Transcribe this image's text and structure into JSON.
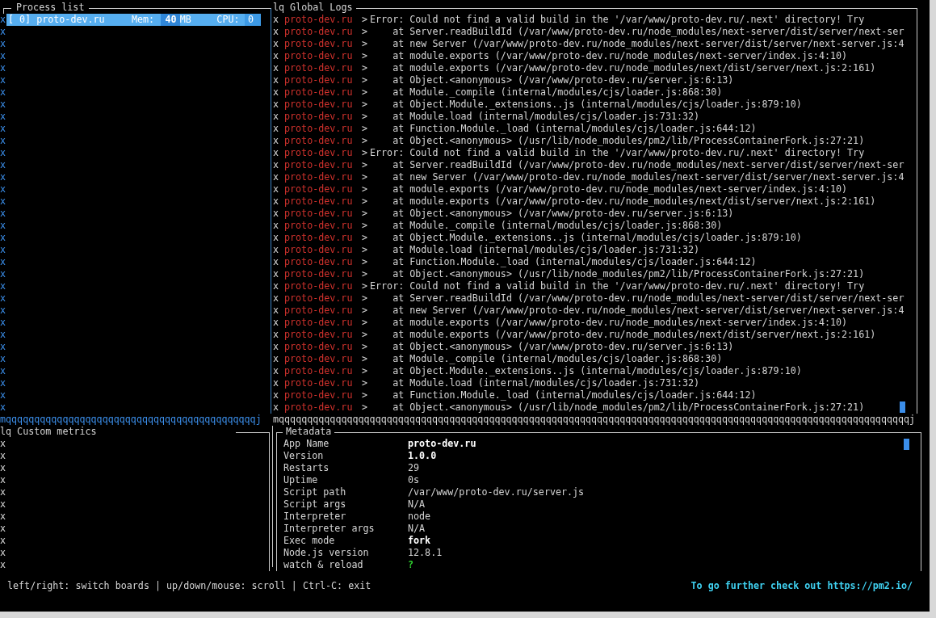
{
  "process_list": {
    "title": "Process list",
    "edge_marks": [
      "x",
      "x",
      "x",
      "x",
      "x",
      "x",
      "x",
      "x",
      "x",
      "x",
      "x",
      "x",
      "x",
      "x",
      "x",
      "x",
      "x",
      "x",
      "x",
      "x",
      "x",
      "x",
      "x",
      "x",
      "x",
      "x",
      "x",
      "x",
      "x",
      "x",
      "x",
      "x",
      "x"
    ],
    "processes": [
      {
        "label": "[ 0] proto-dev.ru",
        "mem_label": "Mem:",
        "mem": "40",
        "mem_unit": "MB",
        "cpu_label": "CPU:",
        "cpu": "0",
        "selected": true
      }
    ],
    "bottom_edge": "mqqqqqqqqqqqqqqqqqqqqqqqqqqqqqqqqqqqqqqqqqqqqj"
  },
  "global_logs": {
    "title": "lq Global Logs",
    "lines": [
      {
        "edge": "x",
        "app": "proto-dev.ru",
        "sep": ">",
        "message": "Error: Could not find a valid build in the '/var/www/proto-dev.ru/.next' directory! Try"
      },
      {
        "edge": "x",
        "app": "proto-dev.ru",
        "sep": ">",
        "message": "    at Server.readBuildId (/var/www/proto-dev.ru/node_modules/next-server/dist/server/next-ser"
      },
      {
        "edge": "x",
        "app": "proto-dev.ru",
        "sep": ">",
        "message": "    at new Server (/var/www/proto-dev.ru/node_modules/next-server/dist/server/next-server.js:4"
      },
      {
        "edge": "x",
        "app": "proto-dev.ru",
        "sep": ">",
        "message": "    at module.exports (/var/www/proto-dev.ru/node_modules/next-server/index.js:4:10)"
      },
      {
        "edge": "x",
        "app": "proto-dev.ru",
        "sep": ">",
        "message": "    at module.exports (/var/www/proto-dev.ru/node_modules/next/dist/server/next.js:2:161)"
      },
      {
        "edge": "x",
        "app": "proto-dev.ru",
        "sep": ">",
        "message": "    at Object.<anonymous> (/var/www/proto-dev.ru/server.js:6:13)"
      },
      {
        "edge": "x",
        "app": "proto-dev.ru",
        "sep": ">",
        "message": "    at Module._compile (internal/modules/cjs/loader.js:868:30)"
      },
      {
        "edge": "x",
        "app": "proto-dev.ru",
        "sep": ">",
        "message": "    at Object.Module._extensions..js (internal/modules/cjs/loader.js:879:10)"
      },
      {
        "edge": "x",
        "app": "proto-dev.ru",
        "sep": ">",
        "message": "    at Module.load (internal/modules/cjs/loader.js:731:32)"
      },
      {
        "edge": "x",
        "app": "proto-dev.ru",
        "sep": ">",
        "message": "    at Function.Module._load (internal/modules/cjs/loader.js:644:12)"
      },
      {
        "edge": "x",
        "app": "proto-dev.ru",
        "sep": ">",
        "message": "    at Object.<anonymous> (/usr/lib/node_modules/pm2/lib/ProcessContainerFork.js:27:21)"
      },
      {
        "edge": "x",
        "app": "proto-dev.ru",
        "sep": ">",
        "message": "Error: Could not find a valid build in the '/var/www/proto-dev.ru/.next' directory! Try"
      },
      {
        "edge": "x",
        "app": "proto-dev.ru",
        "sep": ">",
        "message": "    at Server.readBuildId (/var/www/proto-dev.ru/node_modules/next-server/dist/server/next-ser"
      },
      {
        "edge": "x",
        "app": "proto-dev.ru",
        "sep": ">",
        "message": "    at new Server (/var/www/proto-dev.ru/node_modules/next-server/dist/server/next-server.js:4"
      },
      {
        "edge": "x",
        "app": "proto-dev.ru",
        "sep": ">",
        "message": "    at module.exports (/var/www/proto-dev.ru/node_modules/next-server/index.js:4:10)"
      },
      {
        "edge": "x",
        "app": "proto-dev.ru",
        "sep": ">",
        "message": "    at module.exports (/var/www/proto-dev.ru/node_modules/next/dist/server/next.js:2:161)"
      },
      {
        "edge": "x",
        "app": "proto-dev.ru",
        "sep": ">",
        "message": "    at Object.<anonymous> (/var/www/proto-dev.ru/server.js:6:13)"
      },
      {
        "edge": "x",
        "app": "proto-dev.ru",
        "sep": ">",
        "message": "    at Module._compile (internal/modules/cjs/loader.js:868:30)"
      },
      {
        "edge": "x",
        "app": "proto-dev.ru",
        "sep": ">",
        "message": "    at Object.Module._extensions..js (internal/modules/cjs/loader.js:879:10)"
      },
      {
        "edge": "x",
        "app": "proto-dev.ru",
        "sep": ">",
        "message": "    at Module.load (internal/modules/cjs/loader.js:731:32)"
      },
      {
        "edge": "x",
        "app": "proto-dev.ru",
        "sep": ">",
        "message": "    at Function.Module._load (internal/modules/cjs/loader.js:644:12)"
      },
      {
        "edge": "x",
        "app": "proto-dev.ru",
        "sep": ">",
        "message": "    at Object.<anonymous> (/usr/lib/node_modules/pm2/lib/ProcessContainerFork.js:27:21)"
      },
      {
        "edge": "x",
        "app": "proto-dev.ru",
        "sep": ">",
        "message": "Error: Could not find a valid build in the '/var/www/proto-dev.ru/.next' directory! Try"
      },
      {
        "edge": "x",
        "app": "proto-dev.ru",
        "sep": ">",
        "message": "    at Server.readBuildId (/var/www/proto-dev.ru/node_modules/next-server/dist/server/next-ser"
      },
      {
        "edge": "x",
        "app": "proto-dev.ru",
        "sep": ">",
        "message": "    at new Server (/var/www/proto-dev.ru/node_modules/next-server/dist/server/next-server.js:4"
      },
      {
        "edge": "x",
        "app": "proto-dev.ru",
        "sep": ">",
        "message": "    at module.exports (/var/www/proto-dev.ru/node_modules/next-server/index.js:4:10)"
      },
      {
        "edge": "x",
        "app": "proto-dev.ru",
        "sep": ">",
        "message": "    at module.exports (/var/www/proto-dev.ru/node_modules/next/dist/server/next.js:2:161)"
      },
      {
        "edge": "x",
        "app": "proto-dev.ru",
        "sep": ">",
        "message": "    at Object.<anonymous> (/var/www/proto-dev.ru/server.js:6:13)"
      },
      {
        "edge": "x",
        "app": "proto-dev.ru",
        "sep": ">",
        "message": "    at Module._compile (internal/modules/cjs/loader.js:868:30)"
      },
      {
        "edge": "x",
        "app": "proto-dev.ru",
        "sep": ">",
        "message": "    at Object.Module._extensions..js (internal/modules/cjs/loader.js:879:10)"
      },
      {
        "edge": "x",
        "app": "proto-dev.ru",
        "sep": ">",
        "message": "    at Module.load (internal/modules/cjs/loader.js:731:32)"
      },
      {
        "edge": "x",
        "app": "proto-dev.ru",
        "sep": ">",
        "message": "    at Function.Module._load (internal/modules/cjs/loader.js:644:12)"
      },
      {
        "edge": "x",
        "app": "proto-dev.ru",
        "sep": ">",
        "message": "    at Object.<anonymous> (/usr/lib/node_modules/pm2/lib/ProcessContainerFork.js:27:21)"
      }
    ],
    "bottom_edge": "mqqqqqqqqqqqqqqqqqqqqqqqqqqqqqqqqqqqqqqqqqqqqqqqqqqqqqqqqqqqqqqqqqqqqqqqqqqqqqqqqqqqqqqqqqqqqqqqqqqqqqqqqqqqqqqqj"
  },
  "custom_metrics": {
    "title": "lq Custom metrics",
    "edge_marks": [
      "x",
      "x",
      "x",
      "x",
      "x",
      "x",
      "x",
      "x",
      "x",
      "x",
      "x"
    ]
  },
  "metadata": {
    "title": "Metadata",
    "rows": [
      {
        "label": "App Name",
        "value": "proto-dev.ru",
        "kind": "bold"
      },
      {
        "label": "Version",
        "value": "1.0.0",
        "kind": "bold"
      },
      {
        "label": "Restarts",
        "value": "29",
        "kind": "plain"
      },
      {
        "label": "Uptime",
        "value": "0s",
        "kind": "plain"
      },
      {
        "label": "Script path",
        "value": "/var/www/proto-dev.ru/server.js",
        "kind": "plain"
      },
      {
        "label": "Script args",
        "value": "N/A",
        "kind": "plain"
      },
      {
        "label": "Interpreter",
        "value": "node",
        "kind": "plain"
      },
      {
        "label": "Interpreter args",
        "value": "N/A",
        "kind": "plain"
      },
      {
        "label": "Exec mode",
        "value": "fork",
        "kind": "bold"
      },
      {
        "label": "Node.js version",
        "value": "12.8.1",
        "kind": "plain"
      },
      {
        "label": "watch & reload",
        "value": "?",
        "kind": "ok"
      }
    ]
  },
  "status_bar": {
    "help": "left/right: switch boards | up/down/mouse: scroll | Ctrl-C: exit",
    "link_text": "To go further check out https://pm2.io/"
  }
}
